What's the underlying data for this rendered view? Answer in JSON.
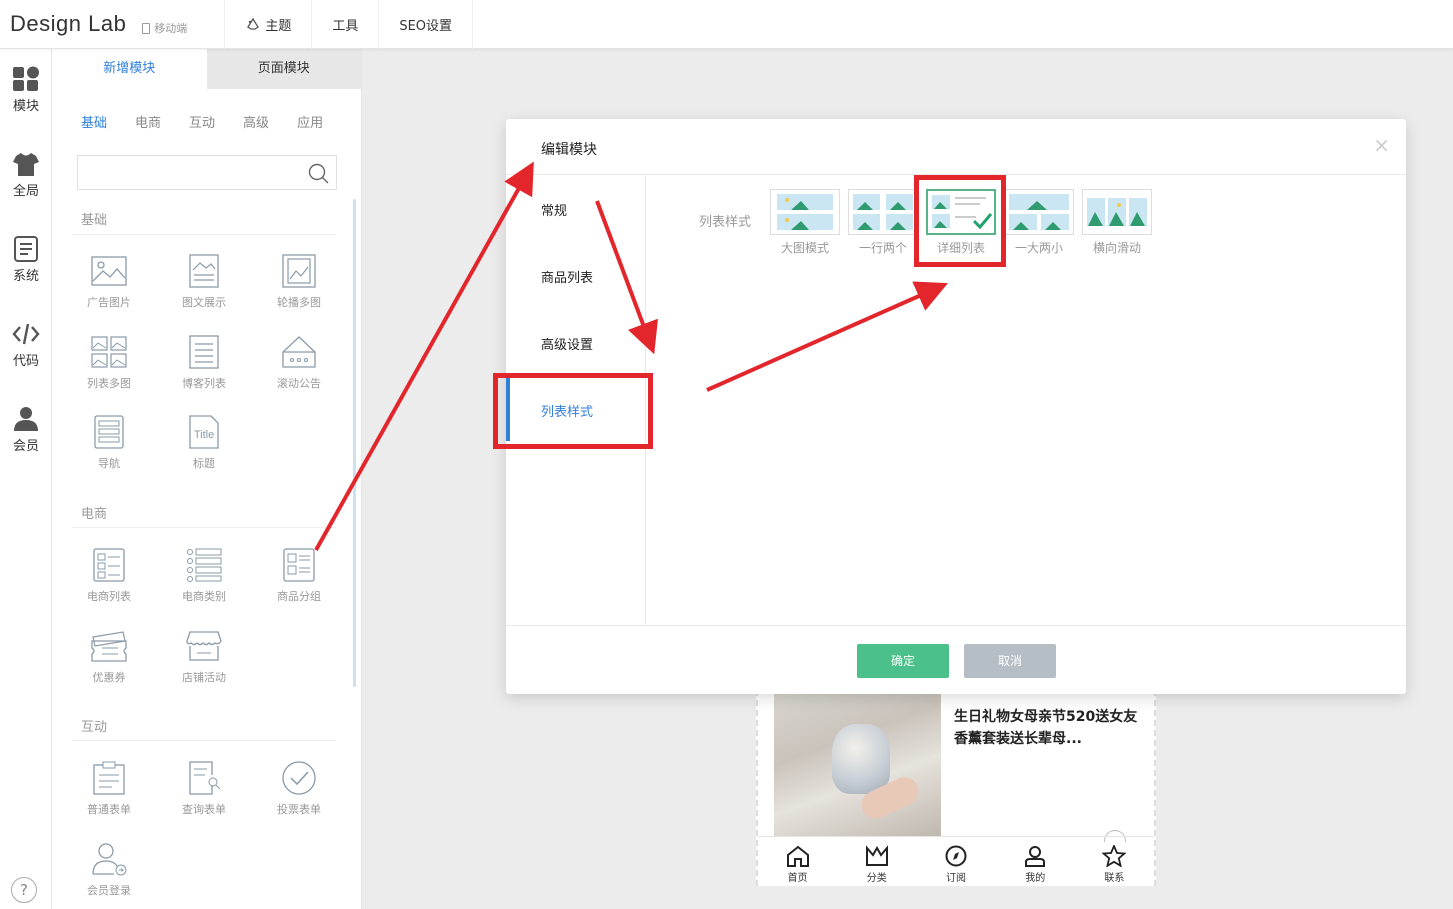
{
  "topbar": {
    "brand": "Design Lab",
    "mobile": "移动端",
    "nav": [
      "主题",
      "工具",
      "SEO设置"
    ]
  },
  "rail": {
    "items": [
      "模块",
      "全局",
      "系统",
      "代码",
      "会员"
    ],
    "help": "?"
  },
  "panel": {
    "tabs": [
      "新增模块",
      "页面模块"
    ],
    "subtabs": [
      "基础",
      "电商",
      "互动",
      "高级",
      "应用"
    ],
    "sections": [
      "基础",
      "电商",
      "互动"
    ],
    "basic": [
      "广告图片",
      "图文展示",
      "轮播多图",
      "列表多图",
      "博客列表",
      "滚动公告",
      "导航",
      "标题"
    ],
    "title_glyph": "Title",
    "ecommerce": [
      "电商列表",
      "电商类别",
      "商品分组",
      "优惠券",
      "店铺活动"
    ],
    "interactive": [
      "普通表单",
      "查询表单",
      "投票表单",
      "会员登录"
    ]
  },
  "dialog": {
    "title": "编辑模块",
    "close": "×",
    "menu": [
      "常规",
      "商品列表",
      "高级设置",
      "列表样式"
    ],
    "style_label": "列表样式",
    "options": [
      "大图模式",
      "一行两个",
      "详细列表",
      "一大两小",
      "横向滑动"
    ],
    "ok": "确定",
    "cancel": "取消"
  },
  "phone": {
    "product_title": "生日礼物女母亲节520送女友香薰套装送长辈母...",
    "nav": [
      "首页",
      "分类",
      "订阅",
      "我的",
      "联系"
    ]
  },
  "colors": {
    "accent": "#2f7fdc",
    "ok": "#4cc08a",
    "cancel": "#b5bec5",
    "annotation": "#e3262c"
  }
}
